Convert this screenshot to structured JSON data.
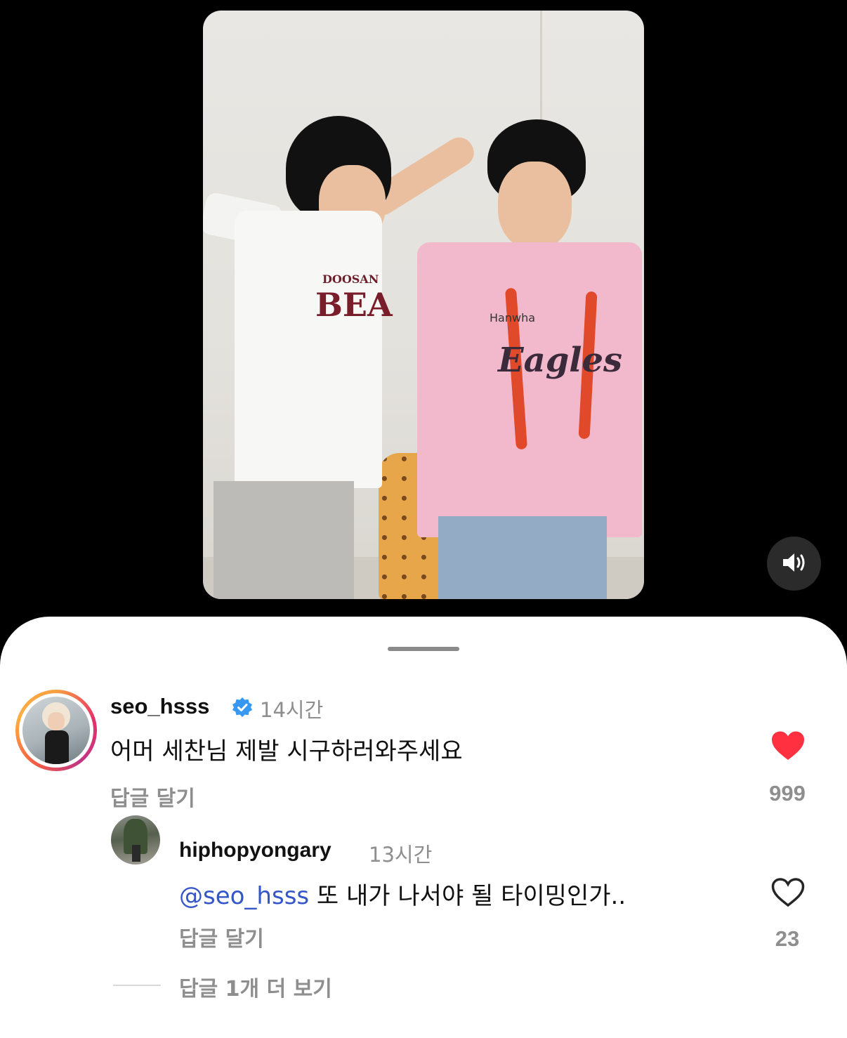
{
  "video": {
    "jersey_left_brand": "DOOSAN",
    "jersey_left_team": "BEA",
    "jersey_right_sponsor": "Hanwha",
    "jersey_right_team": "Eagles",
    "sound_icon": "speaker-icon"
  },
  "comments": [
    {
      "username": "seo_hsss",
      "verified": true,
      "time": "14시간",
      "text": "어머 세찬님 제발 시구하러와주세요",
      "reply_label": "답글 달기",
      "likes": "999",
      "liked": true,
      "like_color": "#ff3040"
    },
    {
      "username": "hiphopyongary",
      "time": "13시간",
      "mention": "@seo_hsss",
      "text": " 또 내가 나서야 될 타이밍인가..",
      "reply_label": "답글 달기",
      "likes": "23",
      "liked": false
    }
  ],
  "more_replies": "답글 1개 더 보기",
  "colors": {
    "verified_badge": "#3897f0",
    "mention": "#3456c8"
  }
}
